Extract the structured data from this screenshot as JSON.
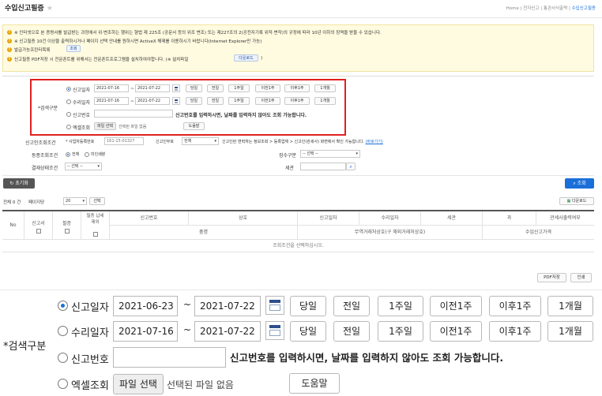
{
  "page": {
    "title": "수입신고필증",
    "breadcrumb": [
      "Home",
      "전자신고",
      "통관서식출력",
      "수입신고필증"
    ],
    "sep": "|"
  },
  "notice": {
    "lines": [
      "※ 인터넷으로 본 증명서를 발급받는 과정에서 위·변조하는 행위는 형법 제 225조 (공문서 등의 위조 변조) 또는 제227조의 2(공전자기록 위작·변작)의 규정에 따라 10년 이하의 징역을 받을 수 있습니다.",
      "※ 신고필증 10건 이상을 출력하시거나 페이지 선택 안내를 원하시면 ActiveX 해제를 이용하시기 바랍니다(Internet Explorer만 가능)",
      "발급가능프린터목록",
      "신고필증 PDF저장 시 전문폰트를 위해서는 전문폰트프로그램을 설치하여야합니다. (※ 설치파일"
    ],
    "printer_btn": "조회",
    "download_btn": "다운로드",
    "close_paren": ")"
  },
  "search": {
    "group_label": "*검색구분",
    "rows": [
      {
        "label": "신고일자",
        "from": "2021-07-16",
        "to": "2021-07-22",
        "selected": true
      },
      {
        "label": "수리일자",
        "from": "2021-07-16",
        "to": "2021-07-22",
        "selected": false
      }
    ],
    "tilde": "~",
    "period_buttons": [
      "당일",
      "전일",
      "1주일",
      "이전1주",
      "이후1주",
      "1개월"
    ],
    "decl_no_label": "신고번호",
    "decl_no_hint": "신고번호를 입력하시면, 날짜를 입력하지 않아도 조회 가능합니다.",
    "excel_label": "엑셀조회",
    "file_btn": "파일 선택",
    "file_none": "선택된 파일 없음",
    "help_btn": "도움말"
  },
  "filters": {
    "issuer_label": "신고인조회조건",
    "biz_no_label": "* 사업자등록번호",
    "biz_no_value": "161-15-01327",
    "decl_type_label": "신고인부호",
    "decl_type_value": "전체",
    "info_text": "신고인란 변력하는 정보조회 > 등록업체 > 신고인(관세사) 화면에서 확인 가능합니다.",
    "info_link": "(바로가기)",
    "same_label": "동종조회조건",
    "opt_all": "전체",
    "opt_not_issued": "미인쇄분",
    "collect_label": "징수구분",
    "collect_value": "-- 선택 --",
    "status_label": "결재상태조건",
    "status_value": "-- 선택 --",
    "customs_label": "세관"
  },
  "toolbar": {
    "reset": "초기화",
    "search": "조회"
  },
  "list": {
    "total": "전체 0 건",
    "per_page_label": "페이지당",
    "per_page_value": "20",
    "select_btn": "선택",
    "download_btn": "다운로드",
    "headers": [
      "No",
      "신고서",
      "필증",
      "필증 납세제외",
      "신고번호",
      "상호",
      "신고일자",
      "수리일자",
      "세관",
      "과",
      "관세사출력여부"
    ],
    "sub_headers": [
      "품명",
      "무역거래처상호(구 해외거래처상호)",
      "수입신고가격"
    ],
    "empty": "조회조건을 선택하십시오."
  },
  "bottom": {
    "pdf": "PDF저장",
    "print": "인쇄"
  },
  "zoom": {
    "group_label": "*검색구분",
    "rows": [
      {
        "label": "신고일자",
        "from": "2021-06-23",
        "to": "2021-07-22",
        "selected": true
      },
      {
        "label": "수리일자",
        "from": "2021-07-16",
        "to": "2021-07-22",
        "selected": false
      }
    ],
    "tilde": "~",
    "period_buttons": [
      "당일",
      "전일",
      "1주일",
      "이전1주",
      "이후1주",
      "1개월"
    ],
    "decl_no_label": "신고번호",
    "decl_no_hint": "신고번호를 입력하시면, 날짜를 입력하지 않아도 조회 가능합니다.",
    "excel_label": "엑셀조회",
    "file_btn": "파일 선택",
    "file_none": "선택된 파일 없음",
    "help_btn": "도움말"
  },
  "colors": {
    "accent": "#1a6fd8",
    "highlight_border": "#e02020",
    "notice_bg": "#fffbe0",
    "notice_bullet": "#e5a100"
  }
}
